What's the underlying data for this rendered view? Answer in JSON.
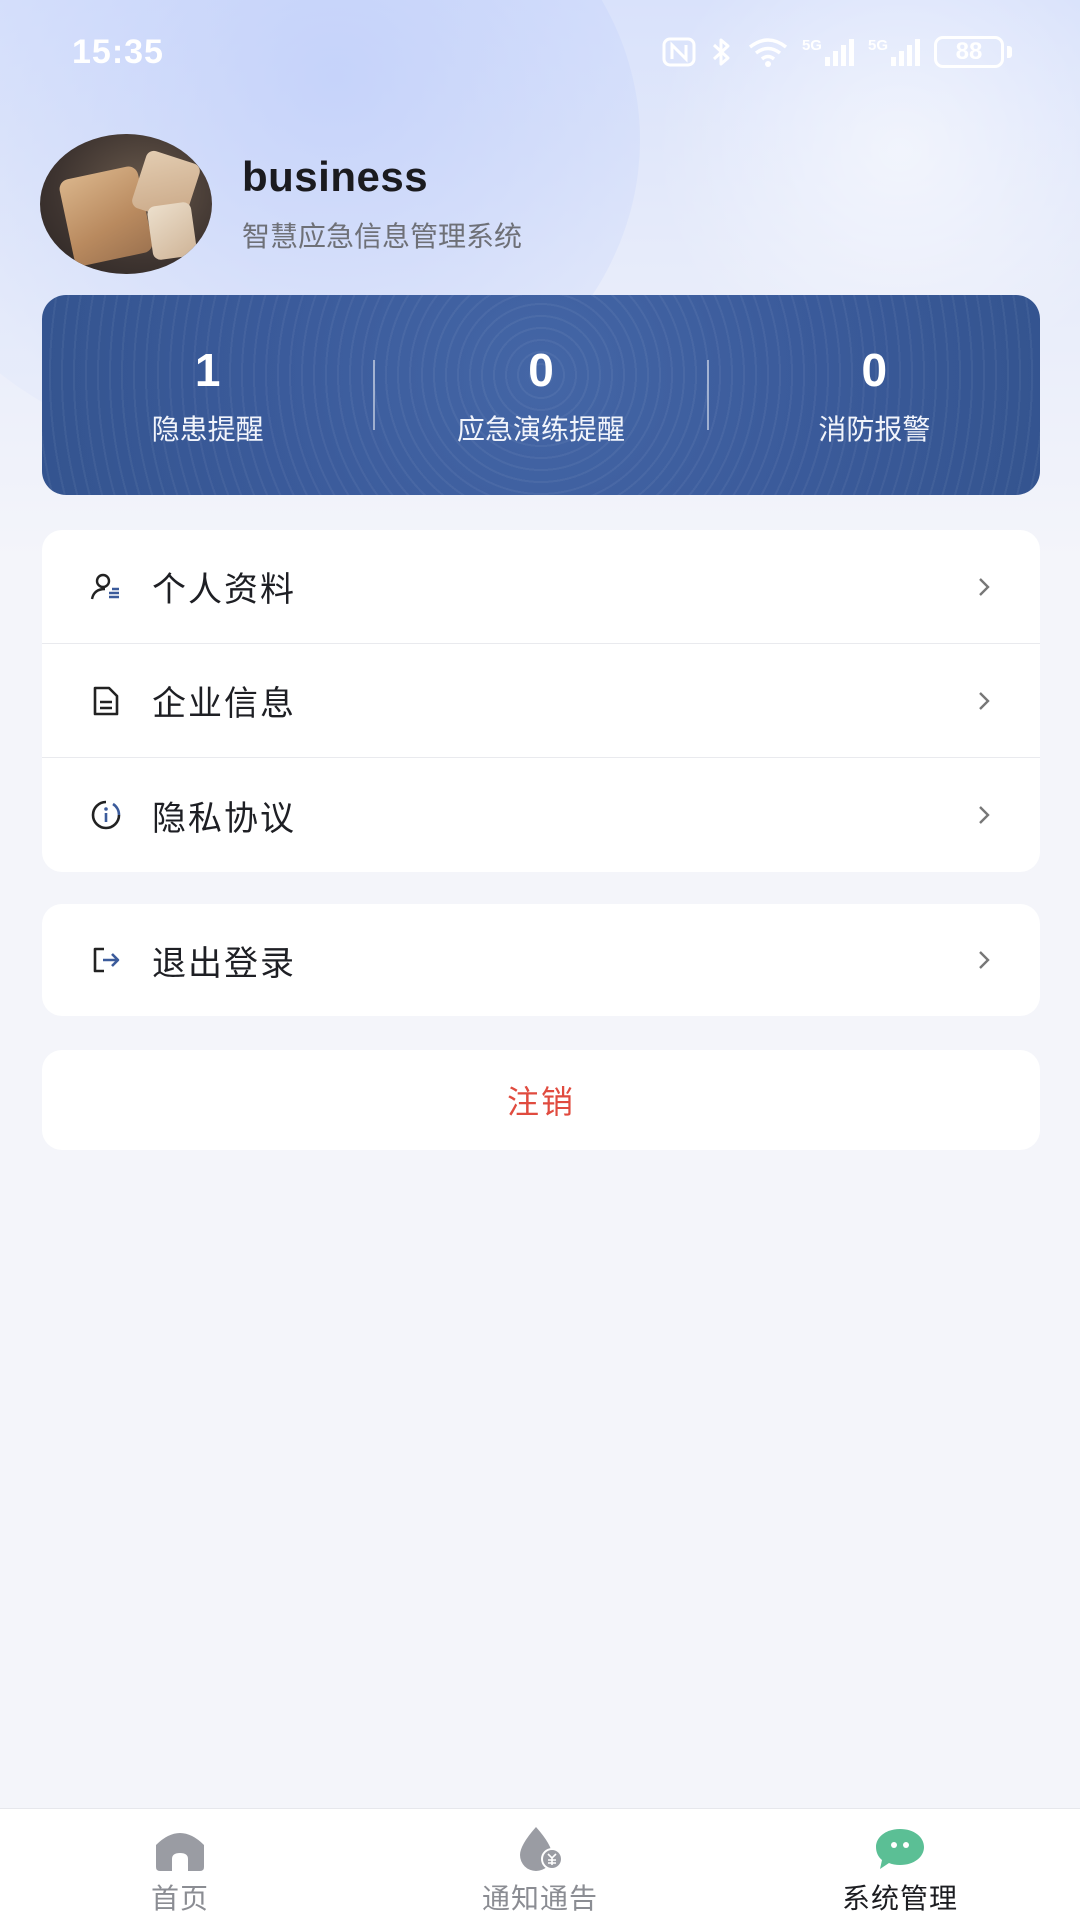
{
  "status_bar": {
    "time": "15:35",
    "battery": "88",
    "network_1": "5G",
    "network_2": "5G",
    "icons": [
      "nfc-icon",
      "bluetooth-icon",
      "wifi-icon",
      "signal-5g-icon",
      "signal-5g-icon",
      "battery-icon"
    ]
  },
  "profile": {
    "name": "business",
    "subtitle": "智慧应急信息管理系统"
  },
  "stats": [
    {
      "value": "1",
      "label": "隐患提醒"
    },
    {
      "value": "0",
      "label": "应急演练提醒"
    },
    {
      "value": "0",
      "label": "消防报警"
    }
  ],
  "menu": {
    "items": [
      {
        "label": "个人资料",
        "icon": "user-profile-icon"
      },
      {
        "label": "企业信息",
        "icon": "document-icon"
      },
      {
        "label": "隐私协议",
        "icon": "info-icon"
      }
    ],
    "logout": {
      "label": "退出登录",
      "icon": "logout-icon"
    },
    "deregister": {
      "label": "注销"
    }
  },
  "bottom_nav": {
    "items": [
      {
        "label": "首页",
        "icon": "home-icon",
        "active": false
      },
      {
        "label": "通知通告",
        "icon": "notice-icon",
        "active": false
      },
      {
        "label": "系统管理",
        "icon": "chat-bubble-icon",
        "active": true
      }
    ]
  },
  "colors": {
    "stats_card": "#3b5b9b",
    "danger": "#e04b3f",
    "active_nav_icon": "#5bbf95",
    "inactive_nav_icon": "#9a9ca3"
  }
}
